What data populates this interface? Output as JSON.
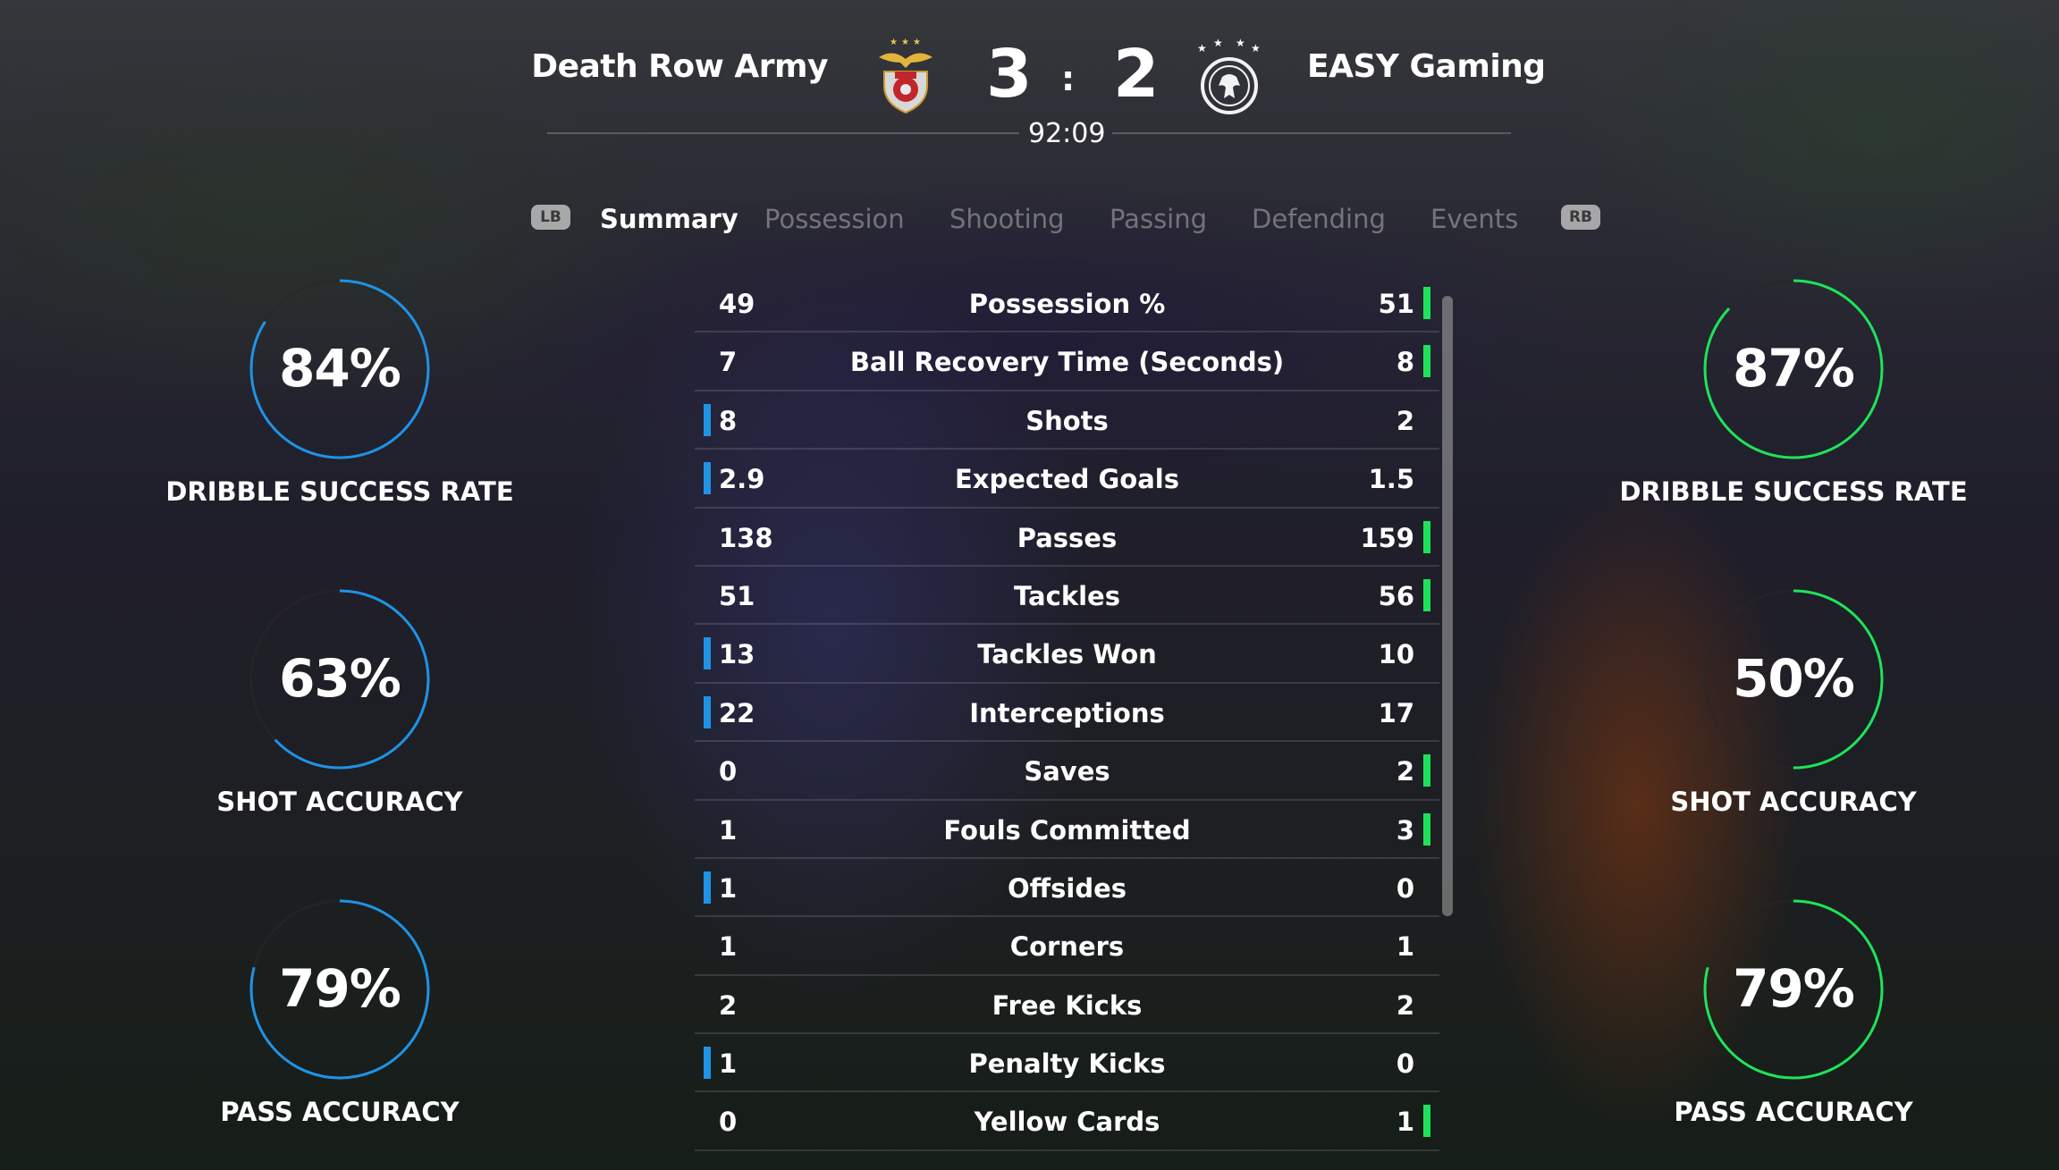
{
  "header": {
    "home_team": "Death Row Army",
    "away_team": "EASY Gaming",
    "home_score": "3",
    "away_score": "2",
    "separator": ":",
    "clock": "92:09",
    "home_crest": "eagle-crest-icon",
    "away_crest": "eagle-crest-with-stars-icon"
  },
  "tabs": {
    "left_bumper": "LB",
    "right_bumper": "RB",
    "items": [
      "Summary",
      "Possession",
      "Shooting",
      "Passing",
      "Defending",
      "Events"
    ],
    "active": "Summary"
  },
  "colors": {
    "home_accent": "#1f93e6",
    "away_accent": "#1ee35a"
  },
  "stats": [
    {
      "label": "Possession %",
      "home": "49",
      "away": "51",
      "leader": "away"
    },
    {
      "label": "Ball Recovery Time (Seconds)",
      "home": "7",
      "away": "8",
      "leader": "away"
    },
    {
      "label": "Shots",
      "home": "8",
      "away": "2",
      "leader": "home"
    },
    {
      "label": "Expected Goals",
      "home": "2.9",
      "away": "1.5",
      "leader": "home"
    },
    {
      "label": "Passes",
      "home": "138",
      "away": "159",
      "leader": "away"
    },
    {
      "label": "Tackles",
      "home": "51",
      "away": "56",
      "leader": "away"
    },
    {
      "label": "Tackles Won",
      "home": "13",
      "away": "10",
      "leader": "home"
    },
    {
      "label": "Interceptions",
      "home": "22",
      "away": "17",
      "leader": "home"
    },
    {
      "label": "Saves",
      "home": "0",
      "away": "2",
      "leader": "away"
    },
    {
      "label": "Fouls Committed",
      "home": "1",
      "away": "3",
      "leader": "away"
    },
    {
      "label": "Offsides",
      "home": "1",
      "away": "0",
      "leader": "home"
    },
    {
      "label": "Corners",
      "home": "1",
      "away": "1",
      "leader": "none"
    },
    {
      "label": "Free Kicks",
      "home": "2",
      "away": "2",
      "leader": "none"
    },
    {
      "label": "Penalty Kicks",
      "home": "1",
      "away": "0",
      "leader": "home"
    },
    {
      "label": "Yellow Cards",
      "home": "0",
      "away": "1",
      "leader": "away"
    }
  ],
  "home_gauges": [
    {
      "value": "84%",
      "fraction": 0.84,
      "label": "DRIBBLE SUCCESS RATE"
    },
    {
      "value": "63%",
      "fraction": 0.63,
      "label": "SHOT ACCURACY"
    },
    {
      "value": "79%",
      "fraction": 0.79,
      "label": "PASS ACCURACY"
    }
  ],
  "away_gauges": [
    {
      "value": "87%",
      "fraction": 0.87,
      "label": "DRIBBLE SUCCESS RATE"
    },
    {
      "value": "50%",
      "fraction": 0.5,
      "label": "SHOT ACCURACY"
    },
    {
      "value": "79%",
      "fraction": 0.79,
      "label": "PASS ACCURACY"
    }
  ]
}
